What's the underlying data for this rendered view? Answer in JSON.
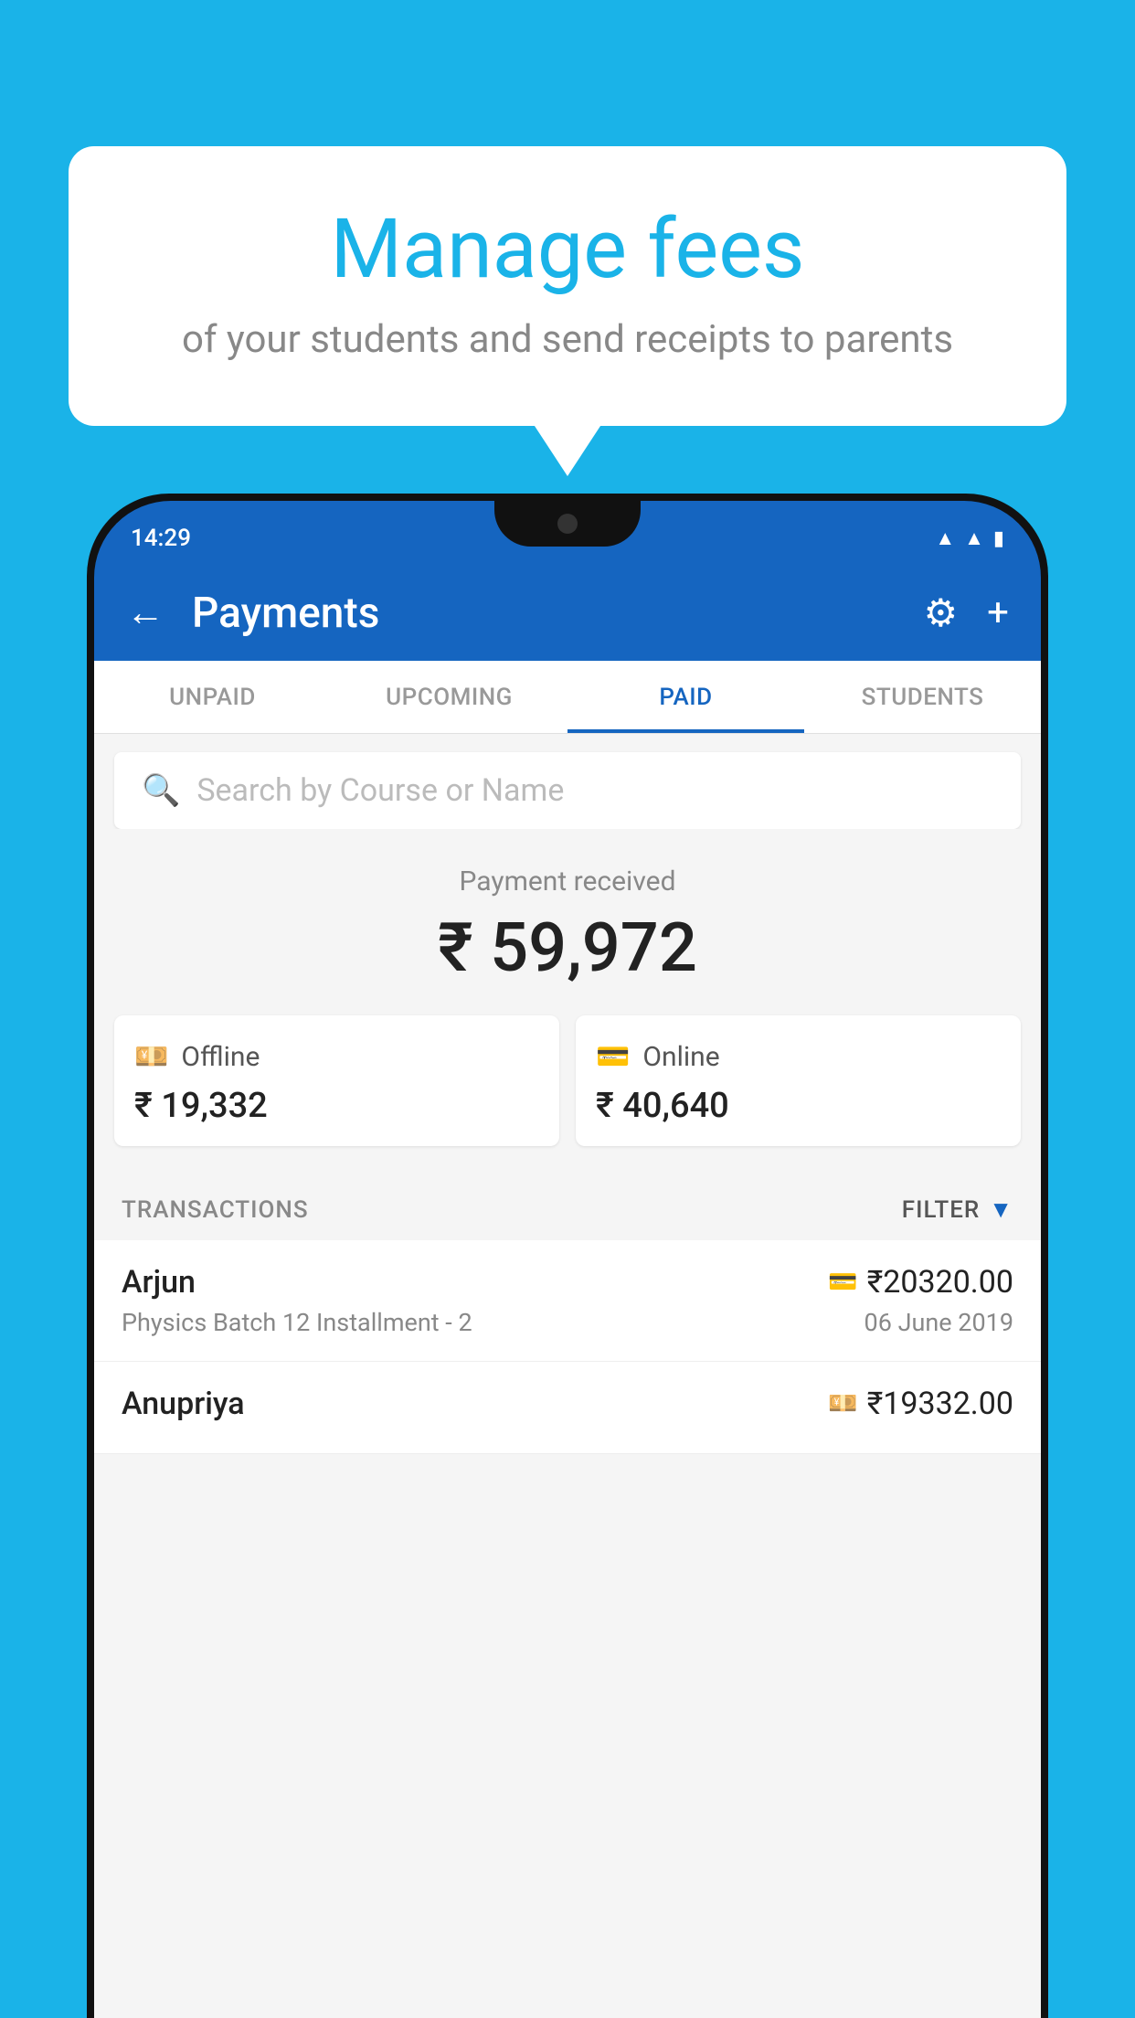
{
  "background_color": "#1ab3e8",
  "bubble": {
    "title": "Manage fees",
    "subtitle": "of your students and send receipts to parents"
  },
  "status_bar": {
    "time": "14:29",
    "icons": [
      "wifi",
      "signal",
      "battery"
    ]
  },
  "app_bar": {
    "title": "Payments",
    "back_label": "←",
    "gear_label": "⚙",
    "plus_label": "+"
  },
  "tabs": [
    {
      "label": "UNPAID",
      "active": false
    },
    {
      "label": "UPCOMING",
      "active": false
    },
    {
      "label": "PAID",
      "active": true
    },
    {
      "label": "STUDENTS",
      "active": false
    }
  ],
  "search": {
    "placeholder": "Search by Course or Name"
  },
  "payment_summary": {
    "label": "Payment received",
    "amount": "₹ 59,972"
  },
  "payment_cards": [
    {
      "icon": "💴",
      "label": "Offline",
      "amount": "₹ 19,332"
    },
    {
      "icon": "💳",
      "label": "Online",
      "amount": "₹ 40,640"
    }
  ],
  "transactions_header": {
    "label": "TRANSACTIONS",
    "filter_label": "FILTER"
  },
  "transactions": [
    {
      "name": "Arjun",
      "amount": "₹20320.00",
      "icon": "💳",
      "description": "Physics Batch 12 Installment - 2",
      "date": "06 June 2019"
    },
    {
      "name": "Anupriya",
      "amount": "₹19332.00",
      "icon": "💴",
      "description": "",
      "date": ""
    }
  ]
}
